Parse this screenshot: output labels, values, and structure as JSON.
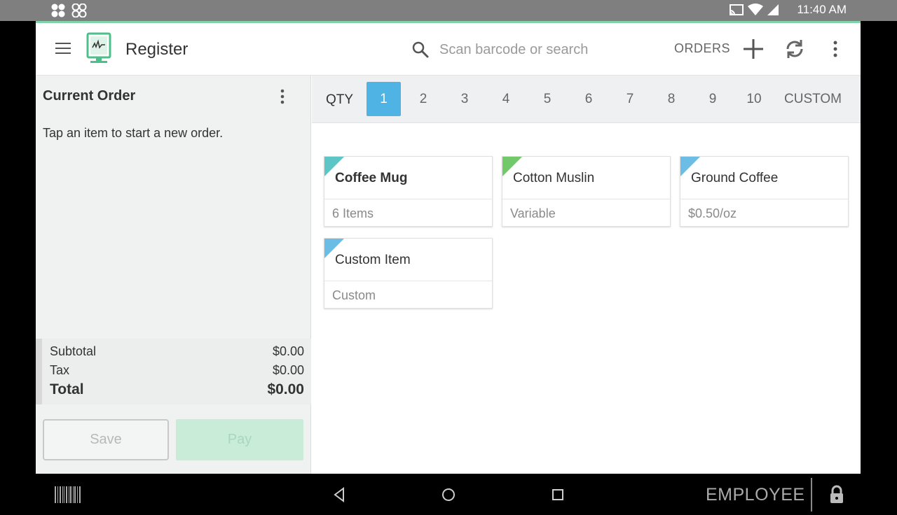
{
  "status_bar": {
    "time": "11:40 AM",
    "left_icons": [
      "clover-icon",
      "clover-icon"
    ],
    "right_icons": [
      "cast-icon",
      "wifi-icon",
      "signal-icon"
    ]
  },
  "header": {
    "title": "Register",
    "search_placeholder": "Scan barcode or search",
    "orders_label": "ORDERS",
    "accent_color": "#7fd3a9"
  },
  "current_order": {
    "title": "Current Order",
    "hint": "Tap an item to start a new order.",
    "subtotal_label": "Subtotal",
    "subtotal_value": "$0.00",
    "tax_label": "Tax",
    "tax_value": "$0.00",
    "total_label": "Total",
    "total_value": "$0.00",
    "save_label": "Save",
    "pay_label": "Pay"
  },
  "quantity": {
    "label": "QTY",
    "options": [
      "1",
      "2",
      "3",
      "4",
      "5",
      "6",
      "7",
      "8",
      "9",
      "10",
      "CUSTOM"
    ],
    "selected": "1",
    "active_color": "#4fb3e4"
  },
  "items": [
    {
      "name": "Coffee Mug",
      "sub": "6 Items",
      "corner_color": "#5cc6c6",
      "bold": true
    },
    {
      "name": "Cotton Muslin",
      "sub": "Variable",
      "corner_color": "#72c96a",
      "bold": false
    },
    {
      "name": "Ground Coffee",
      "sub": "$0.50/oz",
      "corner_color": "#6cbde6",
      "bold": false
    },
    {
      "name": "Custom Item",
      "sub": "Custom",
      "corner_color": "#6cbde6",
      "bold": false
    }
  ],
  "nav_bar": {
    "employee_label": "EMPLOYEE"
  }
}
